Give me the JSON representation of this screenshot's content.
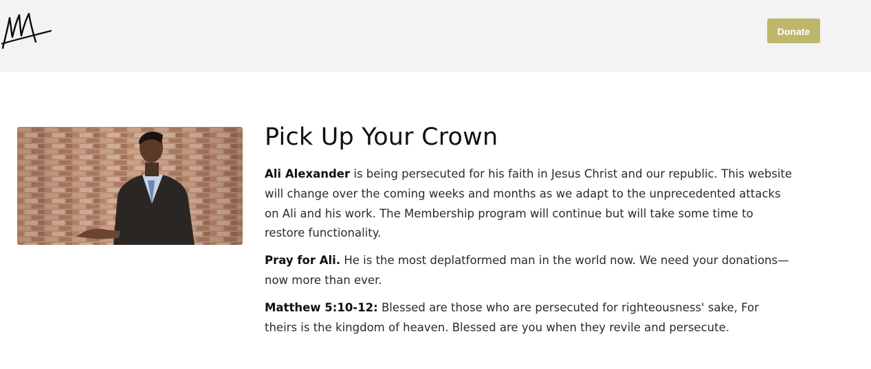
{
  "header": {
    "logo_name": "signature-logo",
    "donate_label": "Donate",
    "donate_color": "#bdb76b",
    "background": "#f3f3f3"
  },
  "main": {
    "title": "Pick Up Your Crown",
    "paragraphs": [
      {
        "lead": "Ali Alexander",
        "text": " is being persecuted for his faith in Jesus Christ and our republic. This website will change over the coming weeks and months as we adapt to the unprecedented attacks on Ali and his work. The Membership program will continue but will take some time to restore functionality."
      },
      {
        "lead": "Pray for Ali.",
        "text": " He is the most deplatformed man in the world now. We need your donations—now more than ever."
      },
      {
        "lead": "Matthew 5:10-12:",
        "text": " Blessed are those who are persecuted for righteousness' sake, For theirs is the kingdom of heaven. Blessed are you when they revile and persecute."
      }
    ]
  }
}
